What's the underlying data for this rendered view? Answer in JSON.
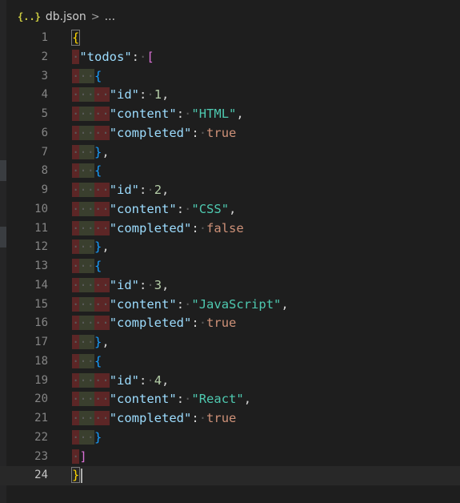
{
  "breadcrumb": {
    "icon_text": "{..}",
    "file_name": "db.json",
    "separator": ">",
    "more": "..."
  },
  "editor": {
    "current_line": 24,
    "lines": [
      {
        "number": "1",
        "indent": 0,
        "tokens": [
          {
            "t": "{",
            "c": "b1",
            "match": true
          }
        ]
      },
      {
        "number": "2",
        "indent": 1,
        "tokens": [
          {
            "t": "\"todos\"",
            "c": "key"
          },
          {
            "t": ":",
            "c": "punc"
          },
          {
            "t": " ",
            "c": "ws"
          },
          {
            "t": "[",
            "c": "b2"
          }
        ]
      },
      {
        "number": "3",
        "indent": 2,
        "tokens": [
          {
            "t": "{",
            "c": "b3"
          }
        ]
      },
      {
        "number": "4",
        "indent": 3,
        "tokens": [
          {
            "t": "\"id\"",
            "c": "key"
          },
          {
            "t": ":",
            "c": "punc"
          },
          {
            "t": " ",
            "c": "ws"
          },
          {
            "t": "1",
            "c": "num"
          },
          {
            "t": ",",
            "c": "punc"
          }
        ]
      },
      {
        "number": "5",
        "indent": 3,
        "tokens": [
          {
            "t": "\"content\"",
            "c": "key"
          },
          {
            "t": ":",
            "c": "punc"
          },
          {
            "t": " ",
            "c": "ws"
          },
          {
            "t": "\"HTML\"",
            "c": "str"
          },
          {
            "t": ",",
            "c": "punc"
          }
        ]
      },
      {
        "number": "6",
        "indent": 3,
        "tokens": [
          {
            "t": "\"completed\"",
            "c": "key"
          },
          {
            "t": ":",
            "c": "punc"
          },
          {
            "t": " ",
            "c": "ws"
          },
          {
            "t": "true",
            "c": "bool"
          }
        ]
      },
      {
        "number": "7",
        "indent": 2,
        "tokens": [
          {
            "t": "}",
            "c": "b3"
          },
          {
            "t": ",",
            "c": "punc"
          }
        ]
      },
      {
        "number": "8",
        "indent": 2,
        "tokens": [
          {
            "t": "{",
            "c": "b3"
          }
        ]
      },
      {
        "number": "9",
        "indent": 3,
        "tokens": [
          {
            "t": "\"id\"",
            "c": "key"
          },
          {
            "t": ":",
            "c": "punc"
          },
          {
            "t": " ",
            "c": "ws"
          },
          {
            "t": "2",
            "c": "num"
          },
          {
            "t": ",",
            "c": "punc"
          }
        ]
      },
      {
        "number": "10",
        "indent": 3,
        "tokens": [
          {
            "t": "\"content\"",
            "c": "key"
          },
          {
            "t": ":",
            "c": "punc"
          },
          {
            "t": " ",
            "c": "ws"
          },
          {
            "t": "\"CSS\"",
            "c": "str"
          },
          {
            "t": ",",
            "c": "punc"
          }
        ]
      },
      {
        "number": "11",
        "indent": 3,
        "tokens": [
          {
            "t": "\"completed\"",
            "c": "key"
          },
          {
            "t": ":",
            "c": "punc"
          },
          {
            "t": " ",
            "c": "ws"
          },
          {
            "t": "false",
            "c": "bool"
          }
        ]
      },
      {
        "number": "12",
        "indent": 2,
        "tokens": [
          {
            "t": "}",
            "c": "b3"
          },
          {
            "t": ",",
            "c": "punc"
          }
        ]
      },
      {
        "number": "13",
        "indent": 2,
        "tokens": [
          {
            "t": "{",
            "c": "b3"
          }
        ]
      },
      {
        "number": "14",
        "indent": 3,
        "tokens": [
          {
            "t": "\"id\"",
            "c": "key"
          },
          {
            "t": ":",
            "c": "punc"
          },
          {
            "t": " ",
            "c": "ws"
          },
          {
            "t": "3",
            "c": "num"
          },
          {
            "t": ",",
            "c": "punc"
          }
        ]
      },
      {
        "number": "15",
        "indent": 3,
        "tokens": [
          {
            "t": "\"content\"",
            "c": "key"
          },
          {
            "t": ":",
            "c": "punc"
          },
          {
            "t": " ",
            "c": "ws"
          },
          {
            "t": "\"JavaScript\"",
            "c": "str"
          },
          {
            "t": ",",
            "c": "punc"
          }
        ]
      },
      {
        "number": "16",
        "indent": 3,
        "tokens": [
          {
            "t": "\"completed\"",
            "c": "key"
          },
          {
            "t": ":",
            "c": "punc"
          },
          {
            "t": " ",
            "c": "ws"
          },
          {
            "t": "true",
            "c": "bool"
          }
        ]
      },
      {
        "number": "17",
        "indent": 2,
        "tokens": [
          {
            "t": "}",
            "c": "b3"
          },
          {
            "t": ",",
            "c": "punc"
          }
        ]
      },
      {
        "number": "18",
        "indent": 2,
        "tokens": [
          {
            "t": "{",
            "c": "b3"
          }
        ]
      },
      {
        "number": "19",
        "indent": 3,
        "tokens": [
          {
            "t": "\"id\"",
            "c": "key"
          },
          {
            "t": ":",
            "c": "punc"
          },
          {
            "t": " ",
            "c": "ws"
          },
          {
            "t": "4",
            "c": "num"
          },
          {
            "t": ",",
            "c": "punc"
          }
        ]
      },
      {
        "number": "20",
        "indent": 3,
        "tokens": [
          {
            "t": "\"content\"",
            "c": "key"
          },
          {
            "t": ":",
            "c": "punc"
          },
          {
            "t": " ",
            "c": "ws"
          },
          {
            "t": "\"React\"",
            "c": "str"
          },
          {
            "t": ",",
            "c": "punc"
          }
        ]
      },
      {
        "number": "21",
        "indent": 3,
        "tokens": [
          {
            "t": "\"completed\"",
            "c": "key"
          },
          {
            "t": ":",
            "c": "punc"
          },
          {
            "t": " ",
            "c": "ws"
          },
          {
            "t": "true",
            "c": "bool"
          }
        ]
      },
      {
        "number": "22",
        "indent": 2,
        "tokens": [
          {
            "t": "}",
            "c": "b3"
          }
        ]
      },
      {
        "number": "23",
        "indent": 1,
        "tokens": [
          {
            "t": "]",
            "c": "b2"
          }
        ]
      },
      {
        "number": "24",
        "indent": 0,
        "tokens": [
          {
            "t": "}",
            "c": "b1",
            "match": true
          }
        ]
      }
    ]
  }
}
